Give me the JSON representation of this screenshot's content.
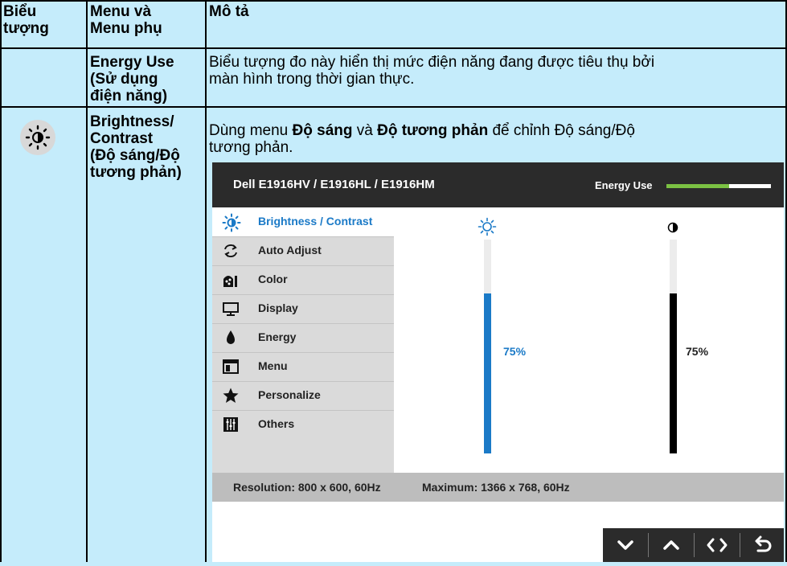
{
  "table": {
    "headers": {
      "icon_line1": "Biểu",
      "icon_line2": "tượng",
      "menu_line1": "Menu và",
      "menu_line2": "Menu phụ",
      "desc": "Mô tả"
    },
    "row1": {
      "menu_line1": "Energy Use",
      "menu_line2": "(Sử dụng",
      "menu_line3": "điện năng)",
      "desc_line1": "Biểu tượng đo này hiển thị mức điện năng đang được tiêu thụ bởi",
      "desc_line2": "màn hình trong thời gian thực."
    },
    "row2": {
      "icon": "brightness-icon",
      "menu_line1": "Brightness/",
      "menu_line2": "Contrast",
      "menu_line3": "(Độ sáng/Độ",
      "menu_line4": "tương phản)",
      "desc_pre": "Dùng menu ",
      "desc_bold1": "Độ sáng",
      "desc_mid": " và ",
      "desc_bold2": "Độ tương phản",
      "desc_post": " để chỉnh Độ sáng/Độ",
      "desc_line2": "tương phản."
    }
  },
  "osd": {
    "model": "Dell E1916HV / E1916HL / E1916HM",
    "energy_label": "Energy Use",
    "energy_level": 0.6,
    "menu_items": [
      {
        "label": "Brightness / Contrast",
        "icon": "brightness-icon",
        "active": true
      },
      {
        "label": "Auto Adjust",
        "icon": "auto-adjust-icon",
        "active": false
      },
      {
        "label": "Color",
        "icon": "color-icon",
        "active": false
      },
      {
        "label": "Display",
        "icon": "display-icon",
        "active": false
      },
      {
        "label": "Energy",
        "icon": "energy-icon",
        "active": false
      },
      {
        "label": "Menu",
        "icon": "menu-icon",
        "active": false
      },
      {
        "label": "Personalize",
        "icon": "star-icon",
        "active": false
      },
      {
        "label": "Others",
        "icon": "others-icon",
        "active": false
      }
    ],
    "brightness": {
      "value_label": "75%",
      "level": 0.75,
      "color": "#1b7ac7"
    },
    "contrast": {
      "value_label": "75%",
      "level": 0.75,
      "color": "#000000"
    },
    "status": {
      "resolution": "Resolution: 800 x 600, 60Hz",
      "maximum": "Maximum: 1366 x 768, 60Hz"
    },
    "nav_buttons": [
      "down-icon",
      "up-icon",
      "left-right-icon",
      "back-icon"
    ]
  },
  "colors": {
    "background": "#c5ecfb",
    "osd_header": "#2b2b2b",
    "accent": "#1b7ac7",
    "energy_green": "#7bc143"
  }
}
